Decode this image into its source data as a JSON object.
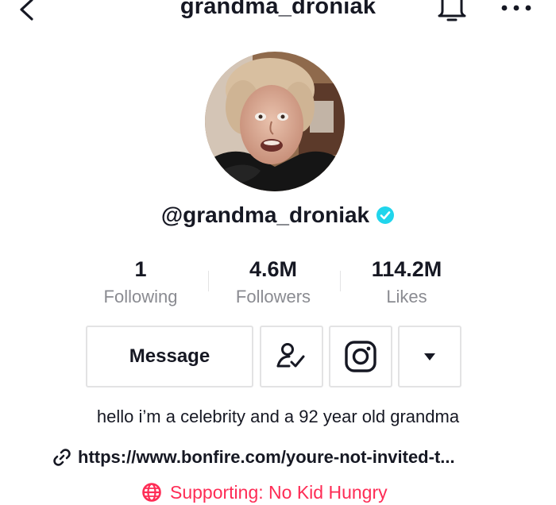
{
  "header": {
    "title": "grandma_droniak"
  },
  "profile": {
    "handle": "@grandma_droniak",
    "verified": true
  },
  "stats": [
    {
      "value": "1",
      "label": "Following"
    },
    {
      "value": "4.6M",
      "label": "Followers"
    },
    {
      "value": "114.2M",
      "label": "Likes"
    }
  ],
  "actions": {
    "message_label": "Message",
    "icons": [
      "unfollow-icon",
      "instagram-icon",
      "caret-down-icon"
    ]
  },
  "bio": {
    "text": "hello i’m a celebrity and a 92 year old grandma",
    "link": "https://www.bonfire.com/youre-not-invited-t...",
    "supporting": "Supporting: No Kid Hungry"
  },
  "colors": {
    "verified": "#20d5ec",
    "supporting": "#fe2c55",
    "muted": "#8a8b91",
    "border": "#e3e3e4"
  }
}
